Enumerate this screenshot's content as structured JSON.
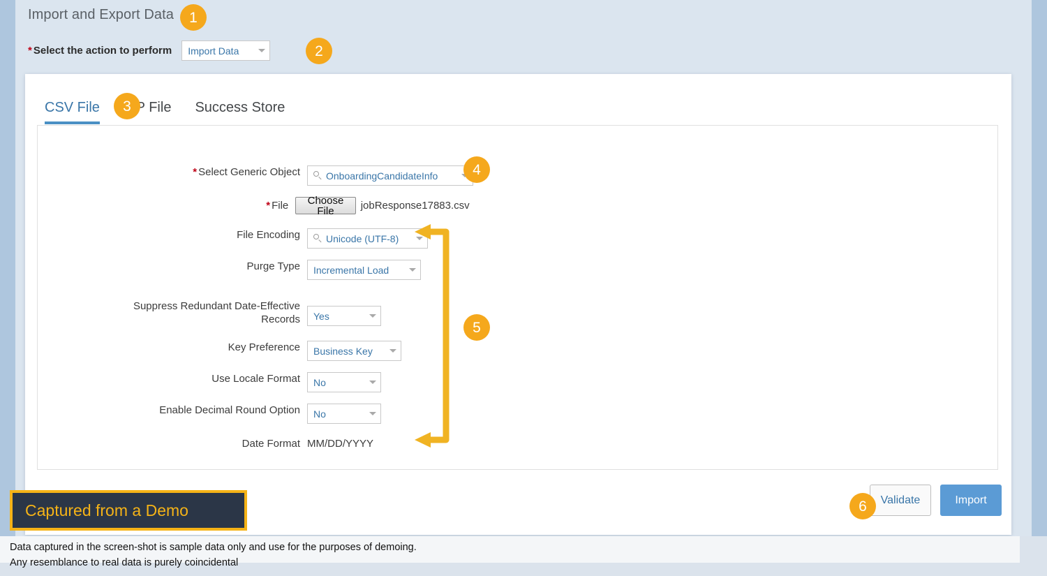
{
  "page": {
    "title": "Import and Export Data"
  },
  "action": {
    "required_mark": "*",
    "label": "Select the action to perform",
    "value": "Import Data",
    "caret_icon": "chevron-down-icon"
  },
  "tabs": [
    {
      "label": "CSV File",
      "active": true
    },
    {
      "label": "ZIP File",
      "active": false
    },
    {
      "label": "Success Store",
      "active": false
    }
  ],
  "form": {
    "rows": [
      {
        "name": "generic-object",
        "label": "Select Generic Object",
        "required": true,
        "type": "search-select",
        "value": "OnboardingCandidateInfo",
        "search_icon": "search-icon",
        "caret_icon": "chevron-down-icon"
      },
      {
        "name": "file",
        "label": "File",
        "required": true,
        "type": "file",
        "button_label": "Choose File",
        "value": "jobResponse17883.csv"
      },
      {
        "name": "file-encoding",
        "label": "File Encoding",
        "required": false,
        "type": "search-select",
        "value": "Unicode (UTF-8)",
        "search_icon": "search-icon",
        "caret_icon": "chevron-down-icon"
      },
      {
        "name": "purge-type",
        "label": "Purge Type",
        "required": false,
        "type": "select",
        "value": "Incremental Load",
        "caret_icon": "chevron-down-icon"
      },
      {
        "name": "suppress-redundant-date-effective-records",
        "label": "Suppress Redundant Date-Effective\nRecords",
        "required": false,
        "type": "select",
        "value": "Yes",
        "caret_icon": "chevron-down-icon"
      },
      {
        "name": "key-preference",
        "label": "Key Preference",
        "required": false,
        "type": "select",
        "value": "Business Key",
        "caret_icon": "chevron-down-icon"
      },
      {
        "name": "use-locale-format",
        "label": "Use Locale Format",
        "required": false,
        "type": "select",
        "value": "No",
        "caret_icon": "chevron-down-icon"
      },
      {
        "name": "enable-decimal-round-option",
        "label": "Enable Decimal Round Option",
        "required": false,
        "type": "select",
        "value": "No",
        "caret_icon": "chevron-down-icon"
      },
      {
        "name": "date-format",
        "label": "Date Format",
        "required": false,
        "type": "static",
        "value": "MM/DD/YYYY"
      }
    ]
  },
  "actions": {
    "validate_label": "Validate",
    "import_label": "Import"
  },
  "callouts": [
    {
      "number": "1"
    },
    {
      "number": "2"
    },
    {
      "number": "3"
    },
    {
      "number": "4"
    },
    {
      "number": "5"
    },
    {
      "number": "6"
    }
  ],
  "annotation": {
    "bracket_icon": "double-arrow-bracket-icon"
  },
  "demo_banner": {
    "text": "Captured from a Demo"
  },
  "footer": {
    "line1": "Data captured in the screen-shot is sample data only and use for the purposes of demoing.",
    "line2": "Any resemblance to real data is purely coincidental"
  },
  "colors": {
    "accent_badge": "#f5a81c",
    "primary_button": "#5b9bd5",
    "link_text": "#3a76a8",
    "required_star": "#c00418",
    "banner_bg": "#2b3647",
    "banner_text": "#f5b317"
  }
}
